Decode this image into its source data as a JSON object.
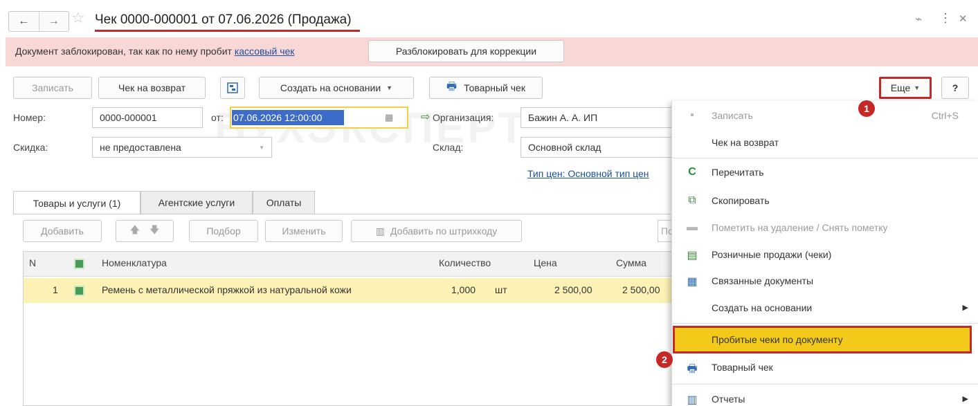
{
  "window": {
    "title": "Чек 0000-000001 от 07.06.2026 (Продажа)"
  },
  "banner": {
    "text": "Документ заблокирован, так как по нему пробит ",
    "link": "кассовый чек",
    "unlock_button": "Разблокировать для коррекции"
  },
  "toolbar": {
    "save": "Записать",
    "return_receipt": "Чек на возврат",
    "create_based_on": "Создать на основании",
    "goods_receipt": "Товарный чек",
    "more": "Еще",
    "help": "?"
  },
  "fields": {
    "number_label": "Номер:",
    "number_value": "0000-000001",
    "date_label": "от:",
    "date_value": "07.06.2026 12:00:00",
    "org_label": "Организация:",
    "org_value": "Бажин А. А. ИП",
    "discount_label": "Скидка:",
    "discount_value": "не предоставлена",
    "warehouse_label": "Склад:",
    "warehouse_value": "Основной склад",
    "price_type_link": "Тип цен: Основной тип цен"
  },
  "tabs": [
    {
      "label": "Товары и услуги (1)"
    },
    {
      "label": "Агентские услуги"
    },
    {
      "label": "Оплаты"
    }
  ],
  "table_toolbar": {
    "add": "Добавить",
    "pick": "Подбор",
    "edit": "Изменить",
    "add_barcode": "Добавить по штрихкоду",
    "search_placeholder": "По"
  },
  "table": {
    "columns": [
      "N",
      "Номенклатура",
      "Количество",
      "Цена",
      "Сумма"
    ],
    "rows": [
      {
        "n": "1",
        "name": "Ремень с металлической пряжкой из натуральной кожи",
        "qty": "1,000",
        "unit": "шт",
        "price": "2 500,00",
        "sum": "2 500,00"
      }
    ]
  },
  "menu": {
    "items": [
      {
        "label": "Записать",
        "shortcut": "Ctrl+S",
        "icon": "save-icon"
      },
      {
        "label": "Чек на возврат"
      },
      {
        "label": "Перечитать",
        "icon": "refresh-icon"
      },
      {
        "label": "Скопировать",
        "icon": "copy-icon"
      },
      {
        "label": "Пометить на удаление / Снять пометку",
        "icon": "delete-mark-icon"
      },
      {
        "label": "Розничные продажи (чеки)",
        "icon": "retail-sales-icon"
      },
      {
        "label": "Связанные документы",
        "icon": "linked-docs-icon"
      },
      {
        "label": "Создать на основании"
      },
      {
        "label": "Пробитые чеки по документу"
      },
      {
        "label": "Товарный чек",
        "icon": "printer-icon"
      },
      {
        "label": "Отчеты",
        "icon": "reports-icon"
      }
    ]
  },
  "badges": {
    "first": "1",
    "second": "2"
  },
  "watermark": "БУХЭКСПЕРТ",
  "colors": {
    "accent_red": "#c62828",
    "highlight_yellow": "#f3c91a",
    "banner_pink": "#f8d7d7",
    "selection_blue": "#3d6bc9",
    "row_yellow": "#fdf2b6"
  }
}
